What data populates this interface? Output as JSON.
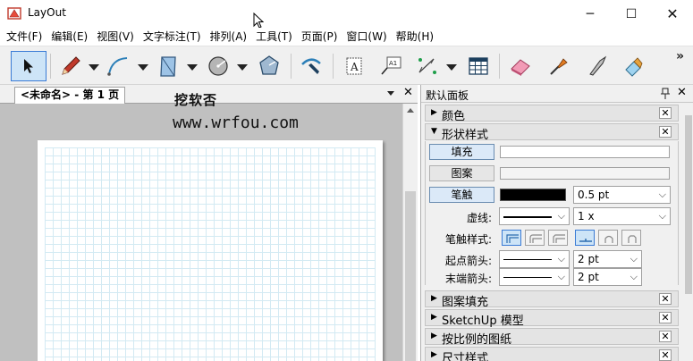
{
  "window": {
    "title": "LayOut",
    "minimize_glyph": "─",
    "maximize_glyph": "☐",
    "close_glyph": "✕"
  },
  "menu": [
    "文件(F)",
    "编辑(E)",
    "视图(V)",
    "文字标注(T)",
    "排列(A)",
    "工具(T)",
    "页面(P)",
    "窗口(W)",
    "帮助(H)"
  ],
  "toolbar": {
    "tools": [
      "select-arrow-icon",
      "pencil-icon",
      "arc-icon",
      "rectangle-icon",
      "circle-icon",
      "polygon-icon",
      "sample-style-icon",
      "text-icon",
      "label-icon",
      "dimension-icon",
      "table-icon",
      "eraser-icon",
      "style-dropper-icon",
      "split-icon",
      "join-icon"
    ],
    "overflow_glyph": "»"
  },
  "document": {
    "tab_label": "<未命名> - 第 1 页",
    "tab_close_glyph": "✕"
  },
  "watermark": {
    "line1": "挖软否",
    "line2": "www.wrfou.com"
  },
  "tray": {
    "title": "默认面板",
    "pin_glyph": "📌",
    "close_glyph": "✕",
    "sections_top": [
      {
        "label": "颜色",
        "expanded": false
      }
    ],
    "shape_style": {
      "label": "形状样式",
      "expanded": true,
      "fill_button": "填充",
      "pattern_button": "图案",
      "stroke_button": "笔触",
      "stroke_width": "0.5 pt",
      "dash_label": "虚线:",
      "dash_scale": "1 x",
      "stroke_style_label": "笔触样式:",
      "start_arrow_label": "起点箭头:",
      "start_arrow_size": "2 pt",
      "end_arrow_label": "末端箭头:",
      "end_arrow_size": "2 pt"
    },
    "sections_bottom": [
      {
        "label": "图案填充",
        "expanded": false
      },
      {
        "label": "SketchUp 模型",
        "expanded": false
      },
      {
        "label": "按比例的图纸",
        "expanded": false
      },
      {
        "label": "尺寸样式",
        "expanded": false
      }
    ]
  },
  "colors": {
    "selected_accent": "#3a7bd5",
    "toolbar_bg": "#f0f0f0",
    "canvas_bg": "#c0c0c0",
    "grid": "#d3eaf3",
    "stroke_color": "#000000"
  }
}
